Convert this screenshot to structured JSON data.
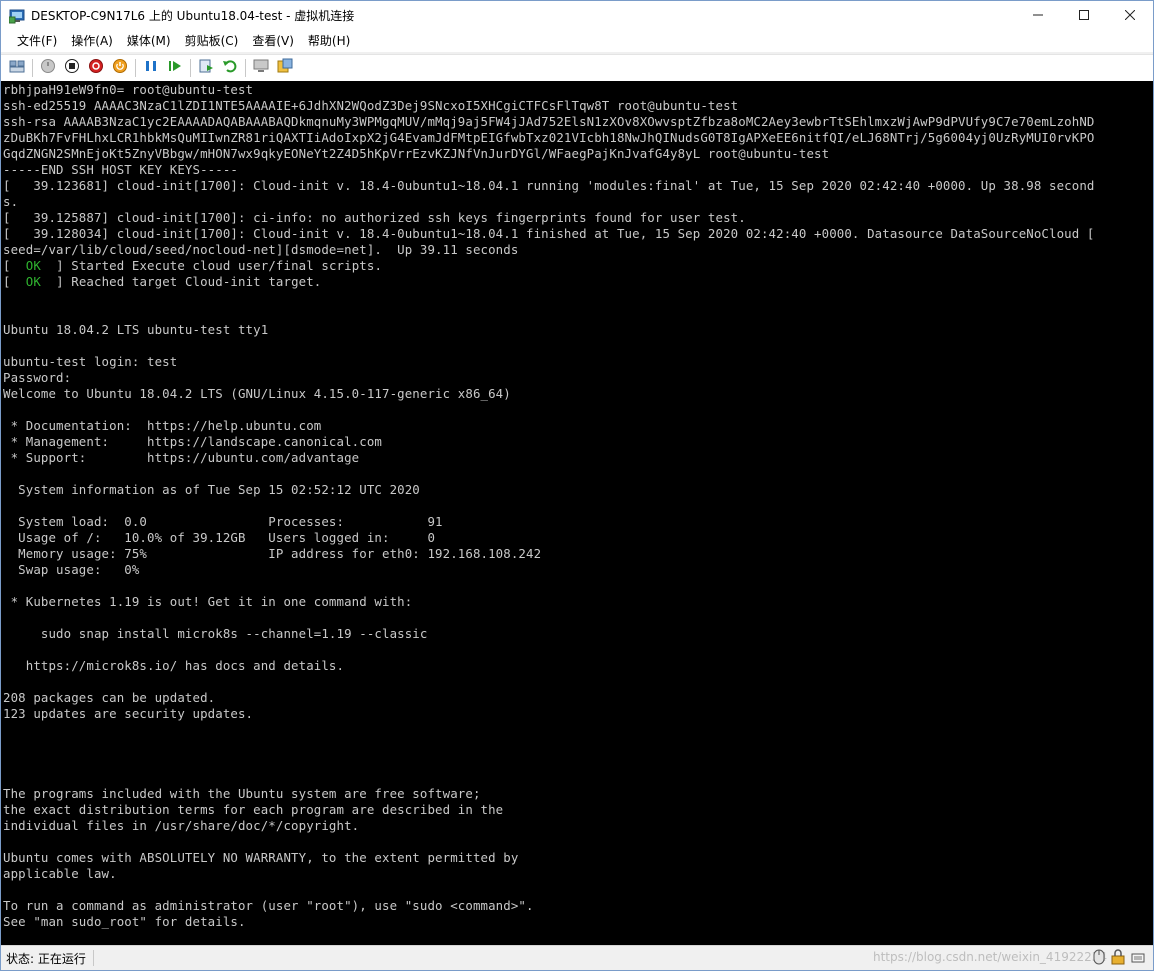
{
  "window": {
    "title": "DESKTOP-C9N17L6 上的 Ubuntu18.04-test - 虚拟机连接",
    "minimize_icon": "minimize-icon",
    "maximize_icon": "maximize-icon",
    "close_icon": "close-icon"
  },
  "menu": [
    "文件(F)",
    "操作(A)",
    "媒体(M)",
    "剪贴板(C)",
    "查看(V)",
    "帮助(H)"
  ],
  "toolbar": {
    "buttons": [
      "ctrl-alt-del-icon",
      "start-icon",
      "turn-off-icon",
      "shut-down-icon",
      "power-icon",
      "pause-icon",
      "resume-icon",
      "checkpoint-icon",
      "revert-icon",
      "enhanced-session-icon",
      "share-icon"
    ]
  },
  "terminal": {
    "lines": [
      "rbhjpaH91eW9fn0= root@ubuntu-test",
      "ssh-ed25519 AAAAC3NzaC1lZDI1NTE5AAAAIE+6JdhXN2WQodZ3Dej9SNcxoI5XHCgiCTFCsFlTqw8T root@ubuntu-test",
      "ssh-rsa AAAAB3NzaC1yc2EAAAADAQABAAABAQDkmqnuMy3WPMgqMUV/mMqj9aj5FW4jJAd752ElsN1zXOv8XOwvsptZfbza8oMC2Aey3ewbrTtSEhlmxzWjAwP9dPVUfy9C7e70emLzohND",
      "zDuBKh7FvFHLhxLCR1hbkMsQuMIIwnZR81riQAXTIiAdoIxpX2jG4EvamJdFMtpEIGfwbTxz021VIcbh18NwJhQINudsG0T8IgAPXeEE6nitfQI/eLJ68NTrj/5g6004yj0UzRyMUI0rvKPO",
      "GqdZNGN2SMnEjoKt5ZnyVBbgw/mHON7wx9qkyEONeYt2Z4D5hKpVrrEzvKZJNfVnJurDYGl/WFaegPajKnJvafG4y8yL root@ubuntu-test",
      "-----END SSH HOST KEY KEYS-----",
      "[   39.123681] cloud-init[1700]: Cloud-init v. 18.4-0ubuntu1~18.04.1 running 'modules:final' at Tue, 15 Sep 2020 02:42:40 +0000. Up 38.98 second",
      "s.",
      "[   39.125887] cloud-init[1700]: ci-info: no authorized ssh keys fingerprints found for user test.",
      "[   39.128034] cloud-init[1700]: Cloud-init v. 18.4-0ubuntu1~18.04.1 finished at Tue, 15 Sep 2020 02:42:40 +0000. Datasource DataSourceNoCloud [",
      "seed=/var/lib/cloud/seed/nocloud-net][dsmode=net].  Up 39.11 seconds",
      "",
      "",
      "",
      "",
      "Ubuntu 18.04.2 LTS ubuntu-test tty1",
      "",
      "ubuntu-test login: test",
      "Password:",
      "Welcome to Ubuntu 18.04.2 LTS (GNU/Linux 4.15.0-117-generic x86_64)",
      "",
      " * Documentation:  https://help.ubuntu.com",
      " * Management:     https://landscape.canonical.com",
      " * Support:        https://ubuntu.com/advantage",
      "",
      "  System information as of Tue Sep 15 02:52:12 UTC 2020",
      "",
      "  System load:  0.0                Processes:           91",
      "  Usage of /:   10.0% of 39.12GB   Users logged in:     0",
      "  Memory usage: 75%                IP address for eth0: 192.168.108.242",
      "  Swap usage:   0%",
      "",
      " * Kubernetes 1.19 is out! Get it in one command with:",
      "",
      "     sudo snap install microk8s --channel=1.19 --classic",
      "",
      "   https://microk8s.io/ has docs and details.",
      "",
      "208 packages can be updated.",
      "123 updates are security updates.",
      "",
      "",
      "",
      "",
      "The programs included with the Ubuntu system are free software;",
      "the exact distribution terms for each program are described in the",
      "individual files in /usr/share/doc/*/copyright.",
      "",
      "Ubuntu comes with ABSOLUTELY NO WARRANTY, to the extent permitted by",
      "applicable law.",
      "",
      "To run a command as administrator (user \"root\"), use \"sudo <command>\".",
      "See \"man sudo_root\" for details."
    ],
    "ok_lines": [
      {
        "ok": "OK",
        "text": "Started Execute cloud user/final scripts."
      },
      {
        "ok": "OK",
        "text": "Reached target Cloud-init target."
      }
    ]
  },
  "status": {
    "text": "状态: 正在运行",
    "watermark": "https://blog.csdn.net/weixin_41922234"
  },
  "colors": {
    "terminal_bg": "#000000",
    "terminal_fg": "#c9c9c9",
    "ok_green": "#2fb42f"
  }
}
